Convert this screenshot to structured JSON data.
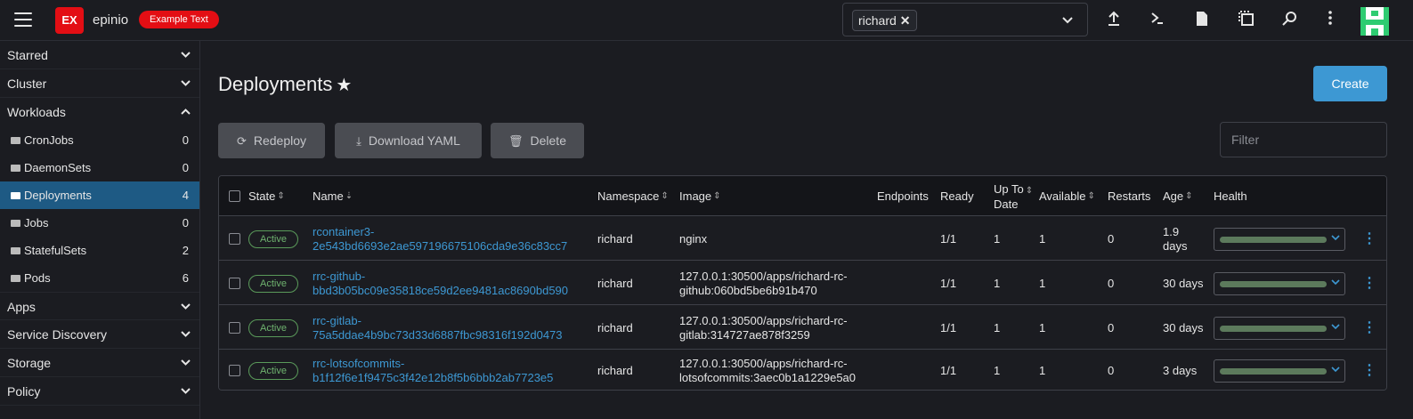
{
  "header": {
    "badge": "EX",
    "cluster": "epinio",
    "pill": "Example Text",
    "namespace_chip": "richard",
    "icons": [
      "upload-icon",
      "terminal-icon",
      "file-icon",
      "copy-config-icon",
      "search-icon",
      "more-vertical-icon"
    ]
  },
  "sidebar": {
    "groups_top": [
      {
        "label": "Starred",
        "chevron": "chevron-down"
      },
      {
        "label": "Cluster",
        "chevron": "chevron-down"
      },
      {
        "label": "Workloads",
        "chevron": "chevron-up"
      }
    ],
    "items": [
      {
        "label": "CronJobs",
        "count": "0"
      },
      {
        "label": "DaemonSets",
        "count": "0"
      },
      {
        "label": "Deployments",
        "count": "4"
      },
      {
        "label": "Jobs",
        "count": "0"
      },
      {
        "label": "StatefulSets",
        "count": "2"
      },
      {
        "label": "Pods",
        "count": "6"
      }
    ],
    "groups_bottom": [
      {
        "label": "Apps"
      },
      {
        "label": "Service Discovery"
      },
      {
        "label": "Storage"
      },
      {
        "label": "Policy"
      }
    ]
  },
  "main": {
    "title": "Deployments",
    "create_label": "Create",
    "actions": {
      "redeploy": "Redeploy",
      "download": "Download YAML",
      "delete": "Delete"
    },
    "filter_placeholder": "Filter"
  },
  "table": {
    "headers": {
      "state": "State",
      "name": "Name",
      "namespace": "Namespace",
      "image": "Image",
      "endpoints": "Endpoints",
      "ready": "Ready",
      "uptodate_1": "Up To",
      "uptodate_2": "Date",
      "available": "Available",
      "restarts": "Restarts",
      "age": "Age",
      "health": "Health"
    },
    "rows": [
      {
        "state": "Active",
        "name_1": "rcontainer3-",
        "name_2": "2e543bd6693e2ae597196675106cda9e36c83cc7",
        "namespace": "richard",
        "image_1": "nginx",
        "image_2": "",
        "ready": "1/1",
        "uptodate": "1",
        "available": "1",
        "restarts": "0",
        "age_1": "1.9",
        "age_2": "days"
      },
      {
        "state": "Active",
        "name_1": "rrc-github-",
        "name_2": "bbd3b05bc09e35818ce59d2ee9481ac8690bd590",
        "namespace": "richard",
        "image_1": "127.0.0.1:30500/apps/richard-rc-",
        "image_2": "github:060bd5be6b91b470",
        "ready": "1/1",
        "uptodate": "1",
        "available": "1",
        "restarts": "0",
        "age_1": "30 days",
        "age_2": ""
      },
      {
        "state": "Active",
        "name_1": "rrc-gitlab-",
        "name_2": "75a5ddae4b9bc73d33d6887fbc98316f192d0473",
        "namespace": "richard",
        "image_1": "127.0.0.1:30500/apps/richard-rc-",
        "image_2": "gitlab:314727ae878f3259",
        "ready": "1/1",
        "uptodate": "1",
        "available": "1",
        "restarts": "0",
        "age_1": "30 days",
        "age_2": ""
      },
      {
        "state": "Active",
        "name_1": "rrc-lotsofcommits-",
        "name_2": "b1f12f6e1f9475c3f42e12b8f5b6bbb2ab7723e5",
        "namespace": "richard",
        "image_1": "127.0.0.1:30500/apps/richard-rc-",
        "image_2": "lotsofcommits:3aec0b1a1229e5a0",
        "ready": "1/1",
        "uptodate": "1",
        "available": "1",
        "restarts": "0",
        "age_1": "3 days",
        "age_2": ""
      }
    ]
  },
  "colors": {
    "accent": "#3d98d3",
    "active_nav": "#1e5a84",
    "brand_red": "#e30e14",
    "active_state": "#6fb36f"
  }
}
